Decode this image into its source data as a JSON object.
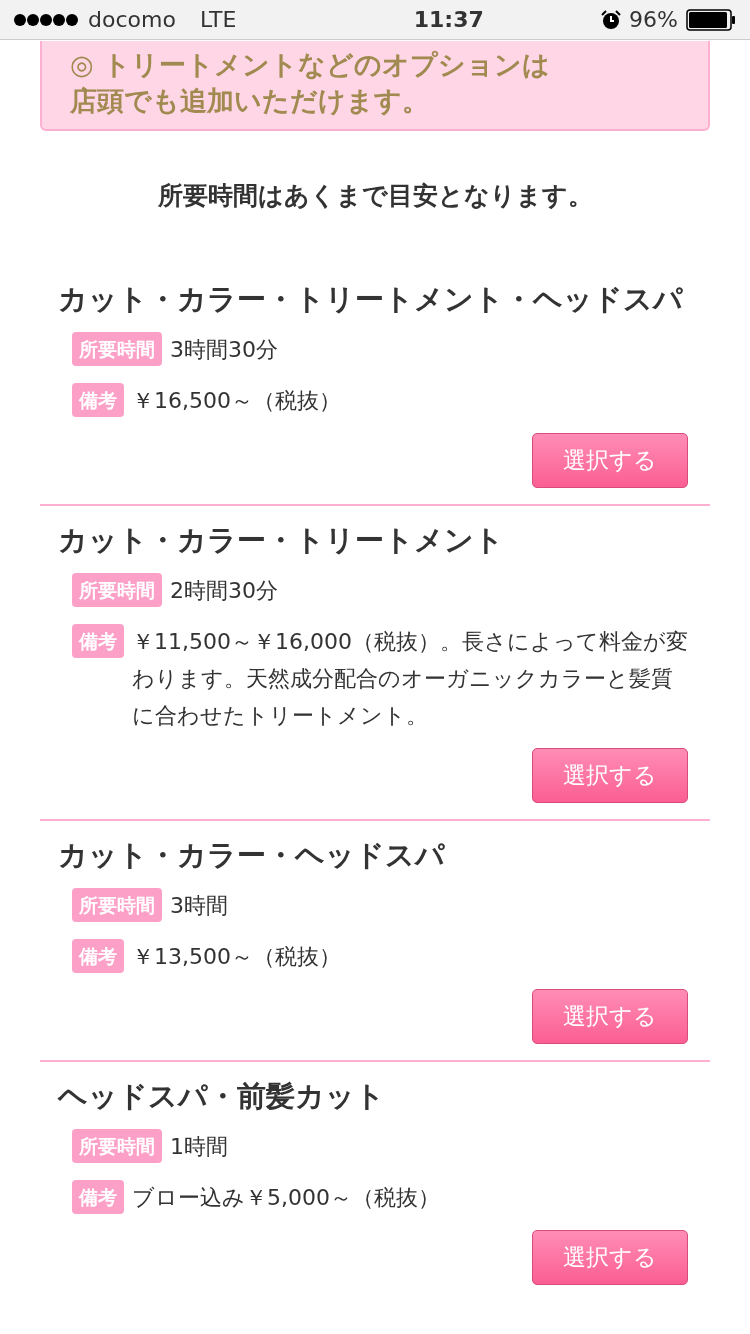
{
  "status_bar": {
    "carrier": "docomo",
    "network": "LTE",
    "time": "11:37",
    "battery_text": "96%"
  },
  "notice": {
    "lines": [
      "◎ トリートメントなどのオプションは",
      "店頭でも追加いただけます。"
    ]
  },
  "note": "所要時間はあくまで目安となります。",
  "menus": [
    {
      "title": "カット・カラー・トリートメント・ヘッドスパ",
      "duration_label": "所要時間",
      "duration": "3時間30分",
      "remarks_label": "備考",
      "remarks": "￥16,500～（税抜）",
      "button": "選択する"
    },
    {
      "title": "カット・カラー・トリートメント",
      "duration_label": "所要時間",
      "duration": "2時間30分",
      "remarks_label": "備考",
      "remarks": "￥11,500～￥16,000（税抜）。長さによって料金が変わります。天然成分配合のオーガニックカラーと髪質に合わせたトリートメント。",
      "button": "選択する"
    },
    {
      "title": "カット・カラー・ヘッドスパ",
      "duration_label": "所要時間",
      "duration": "3時間",
      "remarks_label": "備考",
      "remarks": "￥13,500～（税抜）",
      "button": "選択する"
    },
    {
      "title": "ヘッドスパ・前髪カット",
      "duration_label": "所要時間",
      "duration": "1時間",
      "remarks_label": "備考",
      "remarks": "ブロー込み￥5,000～（税抜）",
      "button": "選択する"
    }
  ]
}
